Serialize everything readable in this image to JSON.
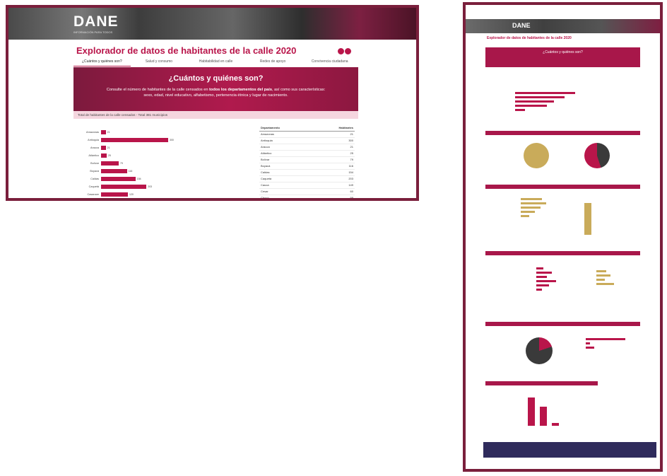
{
  "left": {
    "logo": "DANE",
    "logo_sub": "INFORMACIÓN PARA TODOS",
    "title": "Explorador de datos de habitantes de la calle 2020",
    "tabs": [
      "¿Cuántos y quiénes son?",
      "Salud y consumo",
      "Habitabilidad en calle",
      "Redes de apoyo",
      "Convivencia ciudadana"
    ],
    "hero": {
      "heading": "¿Cuántos y quiénes son?",
      "text_before": "Consulte el número de habitantes de la calle censados en ",
      "text_bold": "todos los departamentos del país",
      "text_after": ", así como sus características: sexo, edad, nivel educativo, alfabetismo, pertenencia étnica y lugar de nacimiento."
    },
    "subbar": "Total de habitantes de la calle censados - Total 381 municipios",
    "bar_chart": [
      {
        "label": "Amazonas",
        "value": 21
      },
      {
        "label": "Antioquia",
        "value": 300
      },
      {
        "label": "Arauca",
        "value": 21
      },
      {
        "label": "Atlántico",
        "value": 25
      },
      {
        "label": "Bolívar",
        "value": 79
      },
      {
        "label": "Boyacá",
        "value": 116
      },
      {
        "label": "Caldas",
        "value": 154
      },
      {
        "label": "Caquetá",
        "value": 203
      },
      {
        "label": "Casanare",
        "value": 120
      }
    ],
    "table": {
      "headers": [
        "Departamento",
        "Habitantes"
      ],
      "rows": [
        [
          "Amazonas",
          "21"
        ],
        [
          "Antioquia",
          "300"
        ],
        [
          "Arauca",
          "21"
        ],
        [
          "Atlántico",
          "25"
        ],
        [
          "Bolívar",
          "79"
        ],
        [
          "Boyacá",
          "116"
        ],
        [
          "Caldas",
          "154"
        ],
        [
          "Caquetá",
          "203"
        ],
        [
          "Cauca",
          "149"
        ],
        [
          "Cesar",
          "60"
        ],
        [
          "Chocó",
          "58"
        ],
        [
          "Córdoba",
          "74"
        ]
      ]
    }
  },
  "right": {
    "logo": "DANE",
    "title": "Explorador de datos de habitantes de la calle 2020",
    "hero_heading": "¿Cuántos y quiénes son?"
  }
}
